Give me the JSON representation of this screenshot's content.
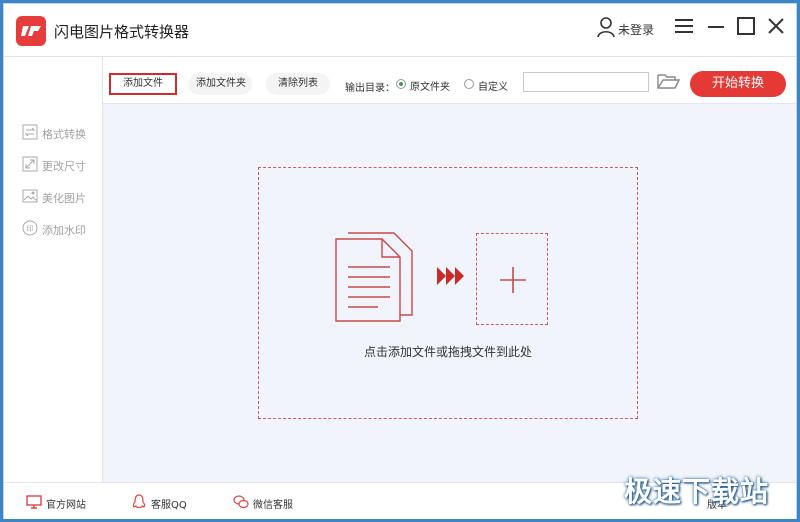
{
  "app": {
    "title": "闪电图片格式转换器"
  },
  "user": {
    "label": "未登录"
  },
  "colors": {
    "accent": "#e53935",
    "radio_selected": "#3aa24a",
    "main_bg": "#f1f4fa"
  },
  "sidebar": {
    "items": [
      {
        "label": "格式转换",
        "icon": "swap-icon"
      },
      {
        "label": "更改尺寸",
        "icon": "resize-icon"
      },
      {
        "label": "美化图片",
        "icon": "image-icon"
      },
      {
        "label": "添加水印",
        "icon": "stamp-icon"
      }
    ]
  },
  "toolbar": {
    "add_file": "添加文件",
    "add_folder": "添加文件夹",
    "clear_list": "清除列表",
    "output_label": "输出目录：",
    "radio_original": "原文件夹",
    "radio_custom": "自定义",
    "selected_output": "原文件夹",
    "path_value": "",
    "start": "开始转换"
  },
  "dropzone": {
    "hint": "点击添加文件或拖拽文件到此处"
  },
  "footer": {
    "website": "官方网站",
    "qq": "客服QQ",
    "wechat": "微信客服",
    "version": "版本"
  },
  "watermark": "极速下载站"
}
